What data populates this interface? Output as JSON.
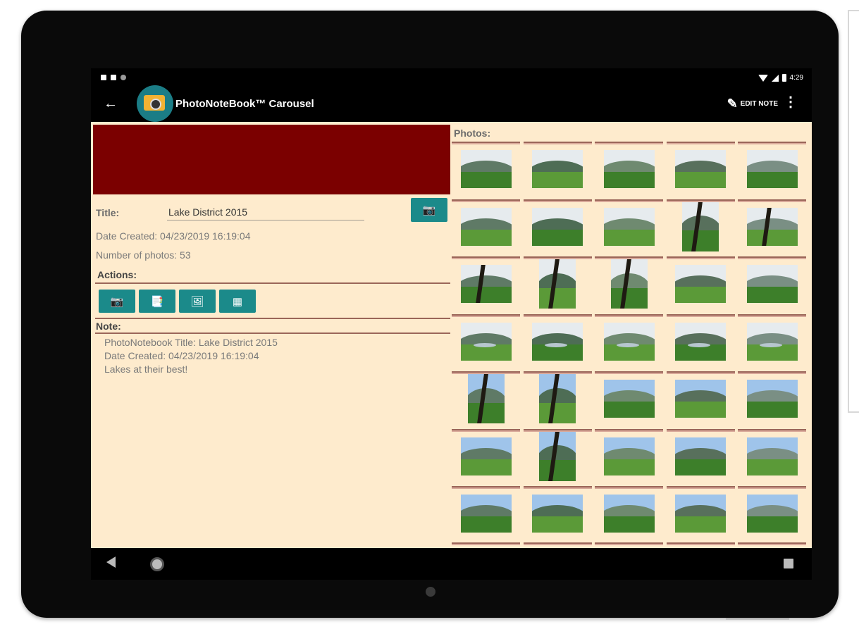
{
  "status_bar": {
    "time": "4:29"
  },
  "app_bar": {
    "title": "PhotoNoteBook™ Carousel",
    "edit_label": "EDIT NOTE",
    "back_icon": "arrow-left-icon",
    "overflow_icon": "more-vert-icon",
    "logo_icon": "camera-logo-icon"
  },
  "details": {
    "title_label": "Title:",
    "title_value": "Lake District 2015",
    "date_created": "Date Created: 04/23/2019  16:19:04",
    "photo_count": "Number of photos: 53",
    "actions_label": "Actions:",
    "note_label": "Note:",
    "banner_color": "#7b0000",
    "accent_color": "#1b8a8a",
    "actions": [
      {
        "icon": "camera-icon"
      },
      {
        "icon": "notebook-icon"
      },
      {
        "icon": "photo-icon"
      },
      {
        "icon": "grid-icon"
      }
    ]
  },
  "note_lines": [
    "PhotoNotebook Title: Lake District 2015",
    "Date Created: 04/23/2019  16:19:04",
    "Lakes at their best!"
  ],
  "photos": {
    "label": "Photos:",
    "count": 35
  },
  "nav_bar": {
    "back_icon": "nav-back-icon",
    "home_icon": "nav-home-icon",
    "recent_icon": "nav-recents-icon"
  }
}
